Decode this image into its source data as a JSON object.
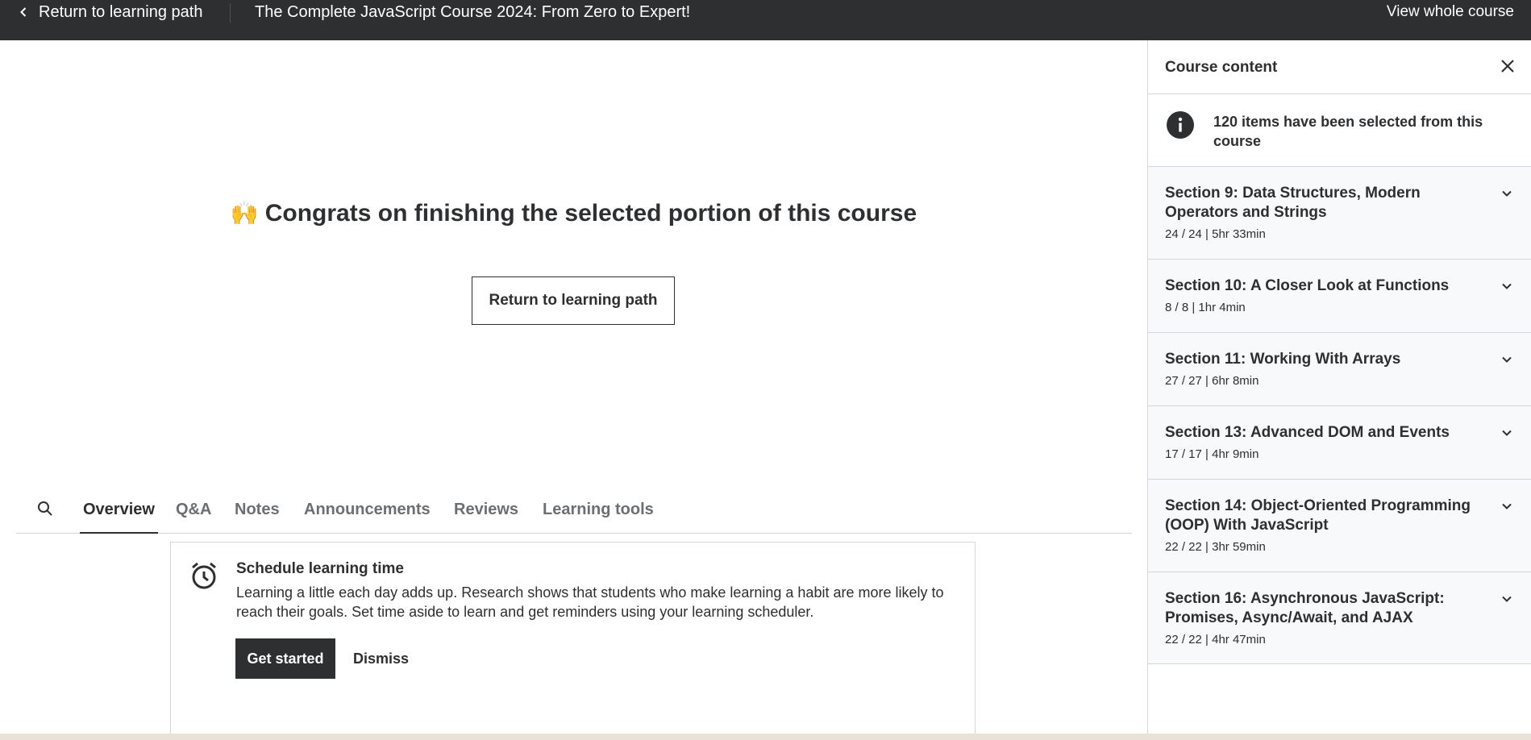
{
  "topbar": {
    "back_label": "Return to learning path",
    "course_title": "The Complete JavaScript Course 2024: From Zero to Expert!",
    "view_whole_label": "View whole course"
  },
  "main": {
    "congrats_emoji": "🙌",
    "congrats_text": "Congrats on finishing the selected portion of this course",
    "return_button_label": "Return to learning path"
  },
  "tabs": [
    {
      "label": "Overview",
      "active": true
    },
    {
      "label": "Q&A",
      "active": false
    },
    {
      "label": "Notes",
      "active": false
    },
    {
      "label": "Announcements",
      "active": false
    },
    {
      "label": "Reviews",
      "active": false
    },
    {
      "label": "Learning tools",
      "active": false
    }
  ],
  "schedule": {
    "title": "Schedule learning time",
    "description": "Learning a little each day adds up. Research shows that students who make learning a habit are more likely to reach their goals. Set time aside to learn and get reminders using your learning scheduler.",
    "get_started_label": "Get started",
    "dismiss_label": "Dismiss"
  },
  "sidebar": {
    "title": "Course content",
    "info_text": "120 items have been selected from this course",
    "sections": [
      {
        "title": "Section 9: Data Structures, Modern Operators and Strings",
        "meta": "24 / 24 | 5hr 33min"
      },
      {
        "title": "Section 10: A Closer Look at Functions",
        "meta": "8 / 8 | 1hr 4min"
      },
      {
        "title": "Section 11: Working With Arrays",
        "meta": "27 / 27 | 6hr 8min"
      },
      {
        "title": "Section 13: Advanced DOM and Events",
        "meta": "17 / 17 | 4hr 9min"
      },
      {
        "title": "Section 14: Object-Oriented Programming (OOP) With JavaScript",
        "meta": "22 / 22 | 3hr 59min"
      },
      {
        "title": "Section 16: Asynchronous JavaScript: Promises, Async/Await, and AJAX",
        "meta": "22 / 22 | 4hr 47min"
      }
    ]
  },
  "colors": {
    "dark": "#2d2f31",
    "border": "#d1d7dc",
    "sidebar_bg": "#f7f9fa",
    "muted": "#6a6f73"
  }
}
